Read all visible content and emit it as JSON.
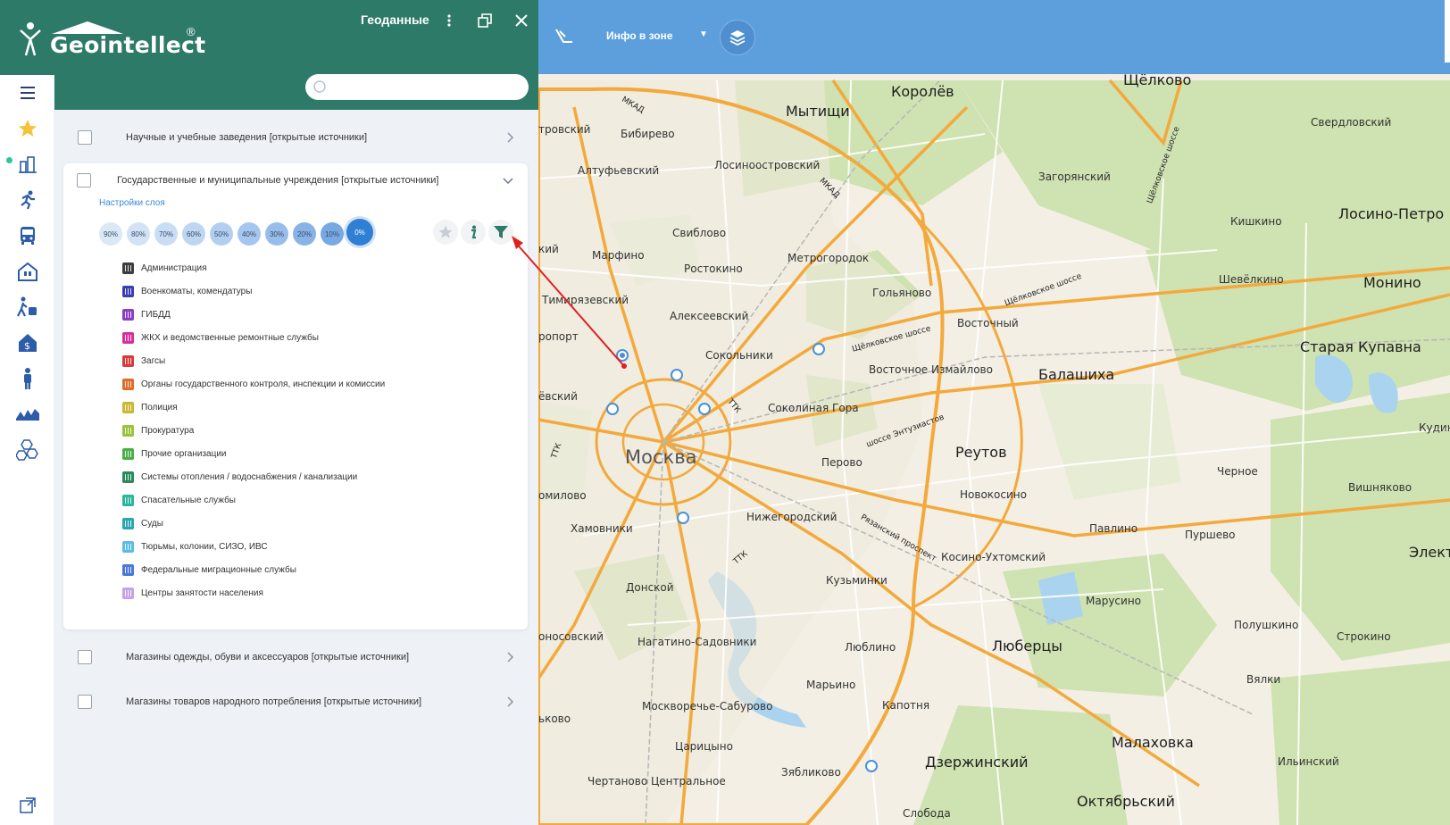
{
  "app": {
    "brand": "Geointellect",
    "brand_mark": "®",
    "panel_title": "Геоданные"
  },
  "search": {
    "placeholder": "",
    "value": ""
  },
  "nav_rail": [
    {
      "icon": "menu-icon"
    },
    {
      "icon": "star-icon"
    },
    {
      "icon": "city-buildings-icon"
    },
    {
      "icon": "sport-runner-icon"
    },
    {
      "icon": "bus-icon"
    },
    {
      "icon": "house-icon"
    },
    {
      "icon": "walker-icon"
    },
    {
      "icon": "money-house-icon"
    },
    {
      "icon": "person-icon"
    },
    {
      "icon": "waves-icon"
    },
    {
      "icon": "hexagons-icon"
    }
  ],
  "layers": {
    "row1": "Научные и учебные заведения [открытые источники]",
    "row2": "Государственные и муниципальные учреждения [открытые источники]",
    "settings_link": "Настройки слоя",
    "opacity": [
      "90%",
      "80%",
      "70%",
      "60%",
      "50%",
      "40%",
      "30%",
      "20%",
      "10%",
      "0%"
    ],
    "opacity_selected": "0%",
    "categories": [
      {
        "label": "Администрация",
        "color": "#3d3d3d"
      },
      {
        "label": "Военкоматы, комендатуры",
        "color": "#3a3fb0"
      },
      {
        "label": "ГИБДД",
        "color": "#8a3fc4"
      },
      {
        "label": "ЖКХ и ведомственные ремонтные службы",
        "color": "#d6309a"
      },
      {
        "label": "Загсы",
        "color": "#d93a3a"
      },
      {
        "label": "Органы государственного контроля, инспекции и комиссии",
        "color": "#e06c2a"
      },
      {
        "label": "Полиция",
        "color": "#c9b832"
      },
      {
        "label": "Прокуратура",
        "color": "#9ac23a"
      },
      {
        "label": "Прочие организации",
        "color": "#4bae46"
      },
      {
        "label": "Системы отопления / водоснабжения / канализации",
        "color": "#2a8a5a"
      },
      {
        "label": "Спасательные службы",
        "color": "#2bb59a"
      },
      {
        "label": "Суды",
        "color": "#2aa7b5"
      },
      {
        "label": "Тюрьмы, колонии, СИЗО, ИВС",
        "color": "#5bbde6"
      },
      {
        "label": "Федеральные миграционные службы",
        "color": "#4a78d8"
      },
      {
        "label": "Центры занятости населения",
        "color": "#c3a5e6"
      }
    ],
    "row3": "Магазины одежды, обуви и аксессуаров [открытые источники]",
    "row4": "Магазины товаров народного потребления [открытые источники]"
  },
  "toolbar": {
    "info_zone": "Инфо в зоне",
    "dropdown_arrow": "▼"
  },
  "map": {
    "city": "Москва",
    "labels": [
      "Королёв",
      "Щёлково",
      "Мытищи",
      "Свердловский",
      "Бибирево",
      "Алтуфьевский",
      "Лосиноостровский",
      "Загорянский",
      "Кишкино",
      "Лосино-Петро",
      "Свиблово",
      "Марфино",
      "Метрогородок",
      "Ростокино",
      "Шевёлкино",
      "Монино",
      "Гольяново",
      "Тимирязевский",
      "Алексеевский",
      "Восточный",
      "Старая Купавна",
      "Сокольники",
      "Восточное Измайлово",
      "Балашиха",
      "Соколиная Гора",
      "Реутов",
      "Перово",
      "Новокосино",
      "Черное",
      "Вишняково",
      "Кудин",
      "Хамовники",
      "Нижегородский",
      "Павлино",
      "Пуршево",
      "Электр",
      "Донской",
      "Кузьминки",
      "Косино-Ухтомский",
      "Марусино",
      "Полушкино",
      "Строкино",
      "Нагатино-Садовники",
      "Люблино",
      "Люберцы",
      "Вялки",
      "Марьино",
      "Москворечье-Сабурово",
      "Капотня",
      "Малаховка",
      "Царицыно",
      "Дзержинский",
      "Ильинский",
      "Зябликово",
      "Чертаново Центральное",
      "Октябрьский",
      "Слобода",
      "тровский",
      "кий",
      "ропорт",
      "ёвский",
      "омилово",
      "оносовский",
      "ьково"
    ],
    "road_labels": [
      "МКАД",
      "МКАД",
      "Щёлковское шоссе",
      "Щёлковское шоссе",
      "Щёлковское шоссе",
      "шоссе Энтузиастов",
      "Рязанский проспект",
      "ТТК",
      "ТТК",
      "ТТК"
    ]
  }
}
